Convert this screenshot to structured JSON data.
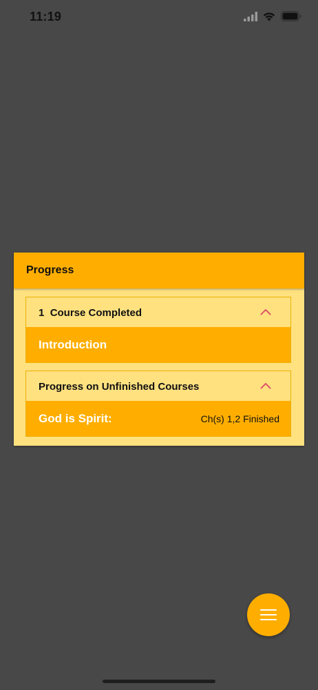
{
  "status_bar": {
    "time": "11:19",
    "icons": [
      "signal-icon",
      "wifi-icon",
      "battery-icon"
    ]
  },
  "card": {
    "title": "Progress",
    "completed_section": {
      "count": "1",
      "label": "Course Completed",
      "expanded": true,
      "courses": [
        "Introduction"
      ]
    },
    "unfinished_section": {
      "label": "Progress on Unfinished Courses",
      "expanded": true,
      "courses": [
        {
          "name": "God is Spirit:",
          "status": "Ch(s) 1,2 Finished"
        }
      ]
    }
  },
  "fab": {
    "icon": "menu-icon"
  },
  "colors": {
    "background": "#484848",
    "accent": "#FFAE00",
    "card_fill": "#FFE180",
    "chevron": "#E0566A"
  }
}
